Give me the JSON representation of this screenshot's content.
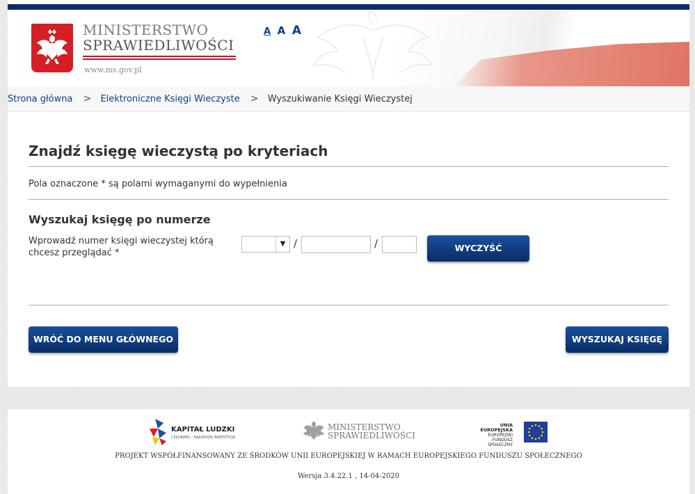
{
  "header": {
    "logo_line1": "MINISTERSTWO",
    "logo_line2": "SPRAWIEDLIWOŚCI",
    "logo_url": "www.ms.gov.pl",
    "font_size_labels": [
      "A",
      "A",
      "A"
    ],
    "colors": {
      "top_bar": "#0d2a6b",
      "emblem_red": "#d41f26",
      "link_blue": "#0d3f8c"
    }
  },
  "breadcrumb": {
    "items": [
      "Strona główna",
      "Elektroniczne Księgi Wieczyste"
    ],
    "current": "Wyszukiwanie Księgi Wieczystej",
    "separator": ">"
  },
  "main": {
    "title": "Znajdź księgę wieczystą po kryteriach",
    "required_note": "Pola oznaczone * są polami wymaganymi do wypełnienia",
    "section_title": "Wyszukaj księgę po numerze",
    "field_label": "Wprowadź numer księgi wieczystej którą chcesz przeglądać *",
    "court_code_selected": "",
    "court_code_arrow": "▼",
    "book_number_value": "",
    "control_digit_value": "",
    "slash": "/",
    "clear_button": "WYCZYŚĆ",
    "back_button": "WRÓĆ DO MENU GŁÓWNEGO",
    "search_button": "WYSZUKAJ KSIĘGĘ",
    "button_color": "#0a2e66"
  },
  "footer": {
    "kl_title": "KAPITAŁ LUDZKI",
    "kl_subtitle": "CZŁOWIEK – NAJLEPSZA INWESTYCJA",
    "ms_line1": "MINISTERSTWO",
    "ms_line2": "SPRAWIEDLIWOŚCI",
    "eu_line1": "UNIA EUROPEJSKA",
    "eu_line2": "EUROPEJSKI",
    "eu_line3": "FUNDUSZ SPOŁECZNY",
    "project_text": "PROJEKT WSPÓŁFINANSOWANY ZE ŚRODKÓW UNII EUROPEJSKIEJ W RAMACH EUROPEJSKIEGO FUNDUSZU SPOŁECZNEGO",
    "version": "Wersja 3.4.22.1 , 14-04-2020"
  }
}
